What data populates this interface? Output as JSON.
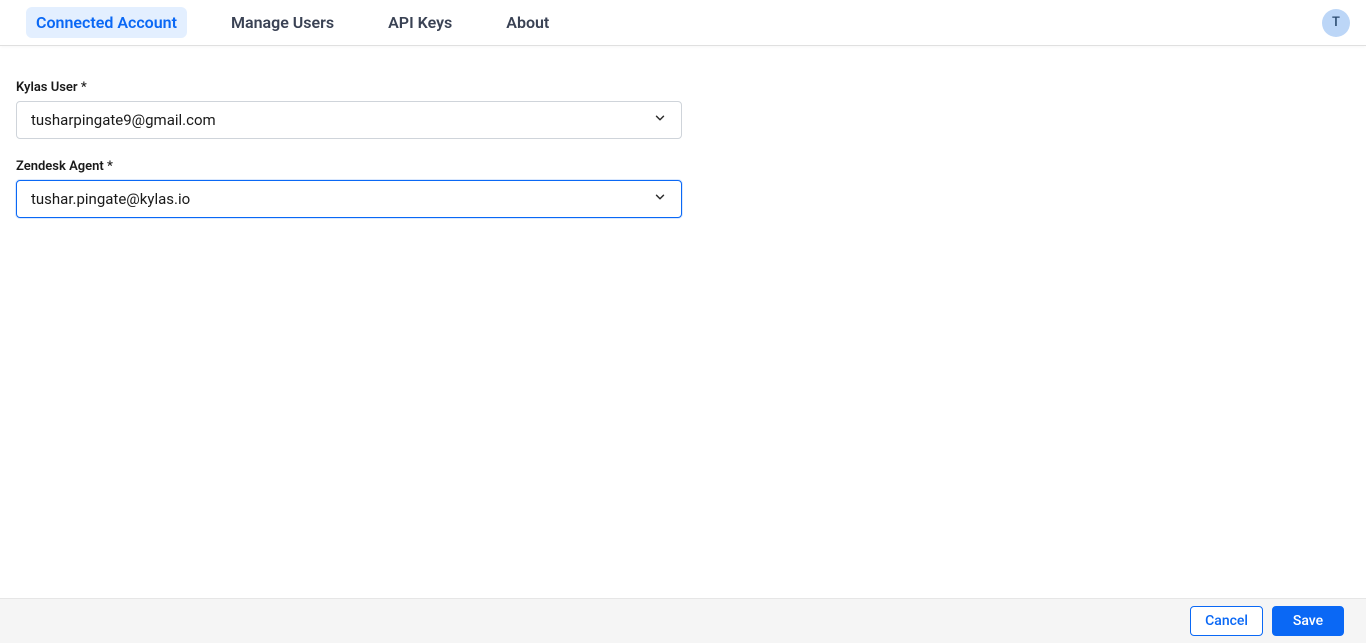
{
  "header": {
    "tabs": [
      {
        "label": "Connected Account",
        "active": true
      },
      {
        "label": "Manage Users",
        "active": false
      },
      {
        "label": "API Keys",
        "active": false
      },
      {
        "label": "About",
        "active": false
      }
    ],
    "avatar_initial": "T"
  },
  "form": {
    "kylas_user": {
      "label": "Kylas User",
      "required": "*",
      "value": "tusharpingate9@gmail.com"
    },
    "zendesk_agent": {
      "label": "Zendesk Agent",
      "required": "*",
      "value": "tushar.pingate@kylas.io"
    }
  },
  "footer": {
    "cancel_label": "Cancel",
    "save_label": "Save"
  }
}
